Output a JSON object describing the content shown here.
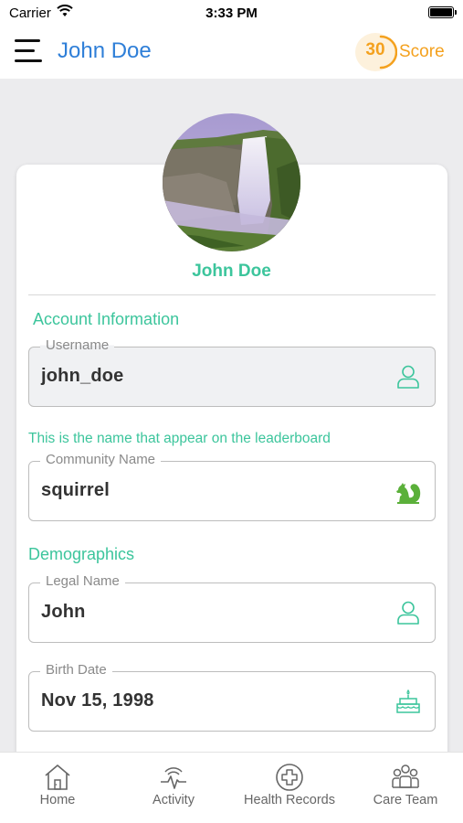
{
  "status_bar": {
    "carrier": "Carrier",
    "time": "3:33 PM"
  },
  "header": {
    "title": "John Doe",
    "score_value": "30",
    "score_label": "Score"
  },
  "profile": {
    "name": "John Doe",
    "avatar": "waterfall-landscape-photo"
  },
  "account_section": {
    "title": "Account Information",
    "username": {
      "label": "Username",
      "value": "john_doe",
      "icon": "user-icon"
    },
    "community_hint": "This is the name that appear on the leaderboard",
    "community_name": {
      "label": "Community Name",
      "value": "squirrel",
      "icon": "squirrel-icon"
    }
  },
  "demographics_section": {
    "title": "Demographics",
    "legal_name": {
      "label": "Legal Name",
      "value": "John",
      "icon": "user-icon"
    },
    "birth_date": {
      "label": "Birth Date",
      "value": "Nov 15, 1998",
      "icon": "birthday-cake-icon"
    }
  },
  "tab_bar": {
    "tabs": [
      {
        "label": "Home",
        "icon": "home-icon"
      },
      {
        "label": "Activity",
        "icon": "activity-icon"
      },
      {
        "label": "Health Records",
        "icon": "health-records-icon"
      },
      {
        "label": "Care Team",
        "icon": "care-team-icon"
      }
    ]
  },
  "colors": {
    "accent_green": "#3cc59c",
    "header_blue": "#2f7fd8",
    "score_orange": "#f4a11e",
    "background": "#ececee"
  }
}
